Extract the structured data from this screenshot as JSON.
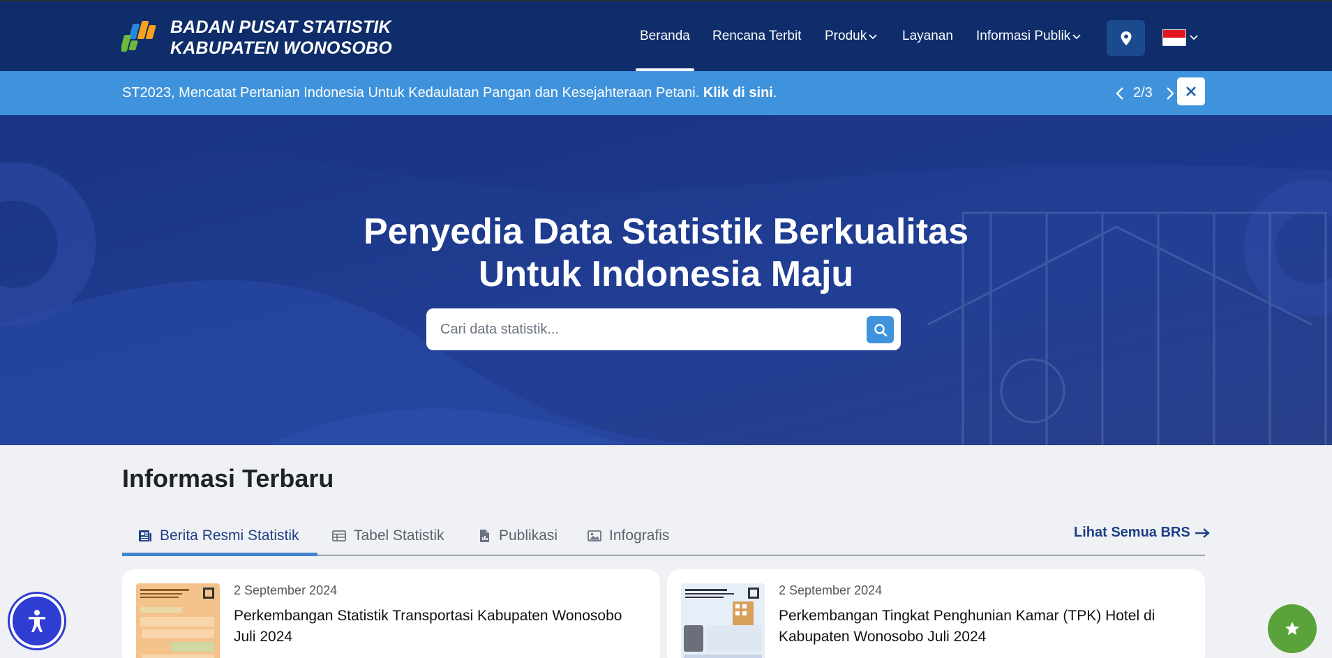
{
  "brand": {
    "line1": "BADAN PUSAT STATISTIK",
    "line2": "KABUPATEN WONOSOBO",
    "logo_icon": "bps-logo-icon"
  },
  "nav": {
    "items": [
      {
        "label": "Beranda",
        "active": true
      },
      {
        "label": "Rencana Terbit"
      },
      {
        "label": "Produk",
        "dropdown": true
      },
      {
        "label": "Layanan"
      },
      {
        "label": "Informasi Publik",
        "dropdown": true
      }
    ],
    "location_icon": "map-pin-icon",
    "language_icon": "indonesia-flag-icon"
  },
  "announcement": {
    "text": "ST2023, Mencatat Pertanian Indonesia Untuk Kedaulatan Pangan dan Kesejahteraan Petani.",
    "link": "Klik di sini",
    "suffix": ".",
    "counter": "2/3"
  },
  "hero": {
    "title_line1": "Penyedia Data Statistik Berkualitas",
    "title_line2": "Untuk Indonesia Maju",
    "search_placeholder": "Cari data statistik..."
  },
  "latest": {
    "heading": "Informasi Terbaru",
    "tabs": [
      {
        "label": "Berita Resmi Statistik",
        "icon": "newspaper-icon",
        "active": true
      },
      {
        "label": "Tabel Statistik",
        "icon": "table-icon"
      },
      {
        "label": "Publikasi",
        "icon": "document-icon"
      },
      {
        "label": "Infografis",
        "icon": "image-icon"
      }
    ],
    "see_all": "Lihat Semua BRS",
    "cards": [
      {
        "date": "2 September 2024",
        "title": "Perkembangan Statistik Transportasi Kabupaten Wonosobo Juli 2024"
      },
      {
        "date": "2 September 2024",
        "title": "Perkembangan Tingkat Penghunian Kamar (TPK) Hotel di Kabupaten Wonosobo Juli 2024"
      }
    ]
  },
  "colors": {
    "header": "#0f2d6b",
    "announcement": "#3f93dc",
    "hero": "#1e3a8a",
    "accent": "#1d3f86",
    "fab_green": "#5aa33a",
    "a11y_blue": "#2f3dd3"
  }
}
